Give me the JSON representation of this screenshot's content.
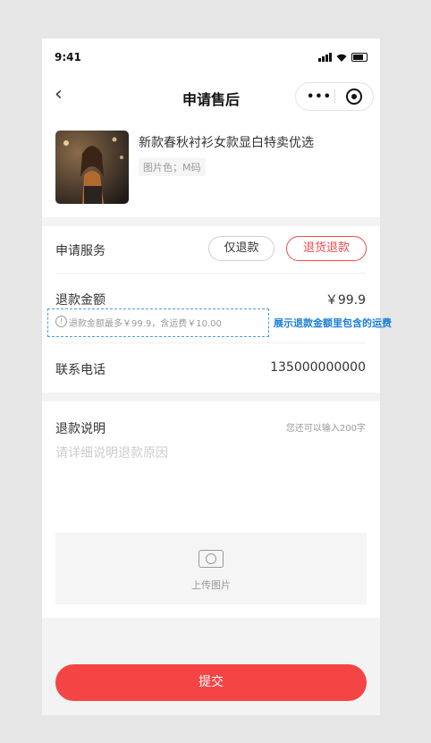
{
  "status_bar": {
    "time": "9:41"
  },
  "nav": {
    "back_icon": "chevron-left-icon",
    "title": "申请售后",
    "more_icon": "more-dots-icon",
    "close_icon": "target-circle-icon",
    "dots": "•••"
  },
  "product": {
    "name": "新款春秋衬衫女款显白特卖优选",
    "spec": "图片色；M码"
  },
  "form": {
    "service_label": "申请服务",
    "service_options": [
      "仅退款",
      "退货退款"
    ],
    "selected_service": "退货退款",
    "refund_label": "退款金额",
    "refund_amount": "￥99.9",
    "refund_hint": "退款金额最多￥99.9，含运费￥10.00",
    "annotation": "展示退款金额里包含的运费",
    "phone_label": "联系电话",
    "phone_value": "135000000000"
  },
  "description": {
    "label": "退款说明",
    "limit_hint": "您还可以输入200字",
    "placeholder": "请详细说明退款原因",
    "upload_label": "上传图片"
  },
  "submit_label": "提交",
  "colors": {
    "accent": "#f44444",
    "annotation": "#1a7fd6",
    "background": "#f3f3f3"
  }
}
